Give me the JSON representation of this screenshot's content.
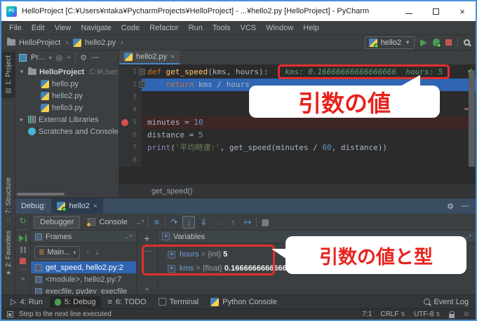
{
  "window": {
    "title": "HelloProject [C:¥Users¥ntaka¥PycharmProjects¥HelloProject] - ...¥hello2.py [HelloProject] - PyCharm"
  },
  "menu": {
    "items": [
      "File",
      "Edit",
      "View",
      "Navigate",
      "Code",
      "Refactor",
      "Run",
      "Tools",
      "VCS",
      "Window",
      "Help"
    ]
  },
  "toolbar": {
    "breadcrumbs": [
      "HelloProject",
      "hello2.py"
    ],
    "run_config": "hello2"
  },
  "left_stripe": {
    "items": [
      {
        "label": "1: Project",
        "icon": "project-tool",
        "active": true
      },
      {
        "label": "7: Structure",
        "icon": "structure-tool",
        "active": false
      },
      {
        "label": "2: Favorites",
        "icon": "favorites-tool",
        "active": false
      }
    ]
  },
  "project_panel": {
    "header": "Pr...",
    "tree": [
      {
        "label": "HelloProject",
        "path": "C:¥Users¥nta",
        "icon": "folder",
        "arrow": "expanded",
        "indent": 0,
        "bold": true
      },
      {
        "label": "hello.py",
        "icon": "python",
        "indent": 1
      },
      {
        "label": "hello2.py",
        "icon": "python",
        "indent": 1
      },
      {
        "label": "hello3.py",
        "icon": "python",
        "indent": 1
      },
      {
        "label": "External Libraries",
        "icon": "libraries",
        "arrow": "collapsed",
        "indent": 0
      },
      {
        "label": "Scratches and Consoles",
        "icon": "scratches",
        "indent": 0
      }
    ]
  },
  "editor": {
    "tab": "hello2.py",
    "inline_hint": "kms: 0.16666666666666666  hours: 5",
    "breadcrumb": "get_speed()",
    "lines": [
      {
        "n": "1",
        "fold": true,
        "hint": true,
        "tokens": [
          {
            "c": "kw",
            "t": "def "
          },
          {
            "c": "fn",
            "t": "get_speed"
          },
          {
            "c": "pl",
            "t": "(kms, hours):"
          }
        ]
      },
      {
        "n": "2",
        "fold": true,
        "sel": true,
        "tokens": [
          {
            "c": "kw",
            "t": "    return "
          },
          {
            "c": "pl",
            "t": "kms / hours"
          }
        ]
      },
      {
        "n": "3",
        "tokens": []
      },
      {
        "n": "4",
        "tokens": []
      },
      {
        "n": "5",
        "bp": true,
        "tokens": [
          {
            "c": "pl",
            "t": "minutes = "
          },
          {
            "c": "num",
            "t": "10"
          }
        ]
      },
      {
        "n": "6",
        "tokens": [
          {
            "c": "pl",
            "t": "distance = "
          },
          {
            "c": "num",
            "t": "5"
          }
        ]
      },
      {
        "n": "7",
        "tokens": [
          {
            "c": "bi",
            "t": "print"
          },
          {
            "c": "pl",
            "t": "("
          },
          {
            "c": "str",
            "t": "'平均時速:'"
          },
          {
            "c": "pl",
            "t": ", get_speed(minutes / "
          },
          {
            "c": "num",
            "t": "60"
          },
          {
            "c": "pl",
            "t": ", distance))"
          }
        ]
      },
      {
        "n": "8",
        "tokens": []
      }
    ]
  },
  "annotations": {
    "bubble1": "引数の値",
    "bubble2": "引数の値と型"
  },
  "debug": {
    "header_label": "Debug:",
    "tab": "hello2",
    "view_tabs": [
      {
        "label": "Debugger",
        "active": true
      },
      {
        "label": "Console",
        "active": false
      }
    ],
    "step_buttons": [
      {
        "name": "show-execution-point",
        "state": "blue"
      },
      {
        "name": "step-over",
        "state": "blue"
      },
      {
        "name": "step-into",
        "state": "selected"
      },
      {
        "name": "force-step-into",
        "state": "blue"
      },
      {
        "name": "step-out-of-block",
        "state": "disabled"
      },
      {
        "name": "step-out",
        "state": "blue"
      },
      {
        "name": "run-to-cursor",
        "state": "blue"
      },
      {
        "name": "evaluate-expression",
        "state": "dim"
      }
    ],
    "frames": {
      "title": "Frames",
      "thread": "Main...",
      "rows": [
        {
          "label": "get_speed, hello2.py:2",
          "selected": true
        },
        {
          "label": "<module>, hello2.py:7",
          "selected": false
        },
        {
          "label": "execfile, pydev_execfile",
          "selected": false
        }
      ]
    },
    "variables": {
      "title": "Variables",
      "rows": [
        {
          "name": "hours",
          "eq": " = ",
          "type": "{int} ",
          "value": "5"
        },
        {
          "name": "kms",
          "eq": " = ",
          "type": "{float} ",
          "value": "0.16666666666666666"
        }
      ]
    }
  },
  "bottom_bar": {
    "tabs": [
      {
        "label": "4: Run",
        "icon": "run",
        "active": false
      },
      {
        "label": "5: Debug",
        "icon": "debug",
        "active": true
      },
      {
        "label": "6: TODO",
        "icon": "todo",
        "active": false
      },
      {
        "label": "Terminal",
        "icon": "terminal",
        "active": false
      },
      {
        "label": "Python Console",
        "icon": "python-console",
        "active": false
      }
    ],
    "event_log": "Event Log"
  },
  "status_bar": {
    "message": "Step to the next line executed",
    "caret": "7:1",
    "line_ending": "CRLF",
    "encoding": "UTF-8"
  }
}
